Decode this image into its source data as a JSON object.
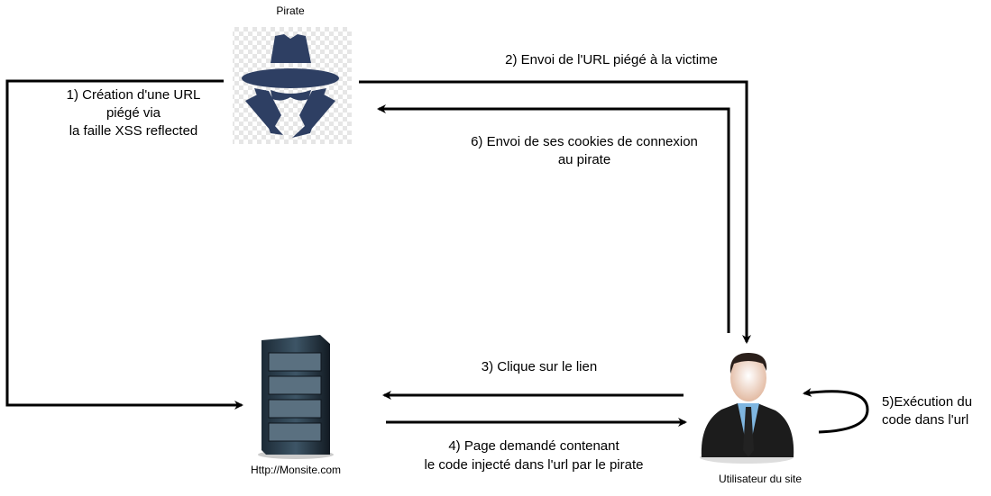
{
  "nodes": {
    "pirate": {
      "label": "Pirate",
      "icon": "spy-icon"
    },
    "server": {
      "label": "Http://Monsite.com",
      "icon": "server-icon"
    },
    "user": {
      "label": "Utilisateur du site",
      "icon": "businessman-icon"
    }
  },
  "steps": {
    "s1": [
      "1) Création d'une URL",
      "piégé via",
      "la faille XSS reflected"
    ],
    "s2": [
      "2) Envoi de l'URL piégé à la victime"
    ],
    "s3": [
      "3) Clique sur le lien"
    ],
    "s4": [
      "4) Page demandé contenant",
      "le code injecté dans l'url par le pirate"
    ],
    "s5": [
      "5)Exécution du",
      "code dans l'url"
    ],
    "s6": [
      "6) Envoi de ses cookies de connexion",
      "au pirate"
    ]
  },
  "colors": {
    "pirate": "#2e3f63",
    "arrow": "#000000",
    "tie": "#222222",
    "shirt": "#7fb6e0"
  }
}
